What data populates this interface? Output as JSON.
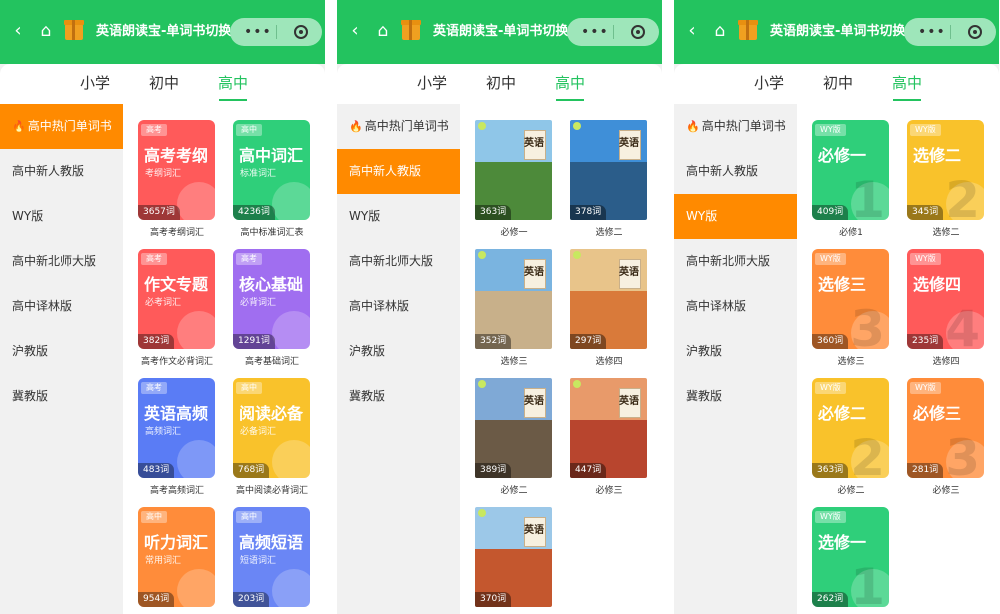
{
  "app": {
    "title": "英语朗读宝-单词书切换",
    "capsule_dots": "•••",
    "icons": [
      "back-icon",
      "home-icon",
      "gift-icon",
      "more-icon",
      "close-icon"
    ],
    "colors": {
      "header": "#23c35f",
      "active_side": "#ff8a00",
      "active_tab": "#23c35f"
    }
  },
  "panels": [
    {
      "tabs": [
        "小学",
        "初中",
        "高中"
      ],
      "active_tab": "高中",
      "side": [
        "高中热门单词书",
        "高中新人教版",
        "WY版",
        "高中新北师大版",
        "高中译林版",
        "沪教版",
        "冀教版"
      ],
      "active_side": "高中热门单词书",
      "cards": [
        {
          "tag": "高考",
          "big": "高考考纲",
          "sub": "考纲词汇",
          "count": "3657词",
          "label": "高考考纲词汇",
          "color": "#ff5a5a"
        },
        {
          "tag": "高中",
          "big": "高中词汇",
          "sub": "标准词汇",
          "count": "4236词",
          "label": "高中标准词汇表",
          "color": "#2fcf7a"
        },
        {
          "tag": "高考",
          "big": "作文专题",
          "sub": "必考词汇",
          "count": "382词",
          "label": "高考作文必背词汇",
          "color": "#ff5a5a"
        },
        {
          "tag": "高考",
          "big": "核心基础",
          "sub": "必背词汇",
          "count": "1291词",
          "label": "高考基础词汇",
          "color": "#a06ef0"
        },
        {
          "tag": "高考",
          "big": "英语高频",
          "sub": "高频词汇",
          "count": "483词",
          "label": "高考高频词汇",
          "color": "#5a7cf5"
        },
        {
          "tag": "高中",
          "big": "阅读必备",
          "sub": "必备词汇",
          "count": "768词",
          "label": "高中阅读必背词汇",
          "color": "#f9c22b"
        },
        {
          "tag": "高中",
          "big": "听力词汇",
          "sub": "常用词汇",
          "count": "954词",
          "label": "",
          "color": "#ff8c3a"
        },
        {
          "tag": "高中",
          "big": "高频短语",
          "sub": "短语词汇",
          "count": "203词",
          "label": "",
          "color": "#6a86f5"
        }
      ]
    },
    {
      "tabs": [
        "小学",
        "初中",
        "高中"
      ],
      "active_tab": "高中",
      "side": [
        "高中热门单词书",
        "高中新人教版",
        "WY版",
        "高中新北师大版",
        "高中译林版",
        "沪教版",
        "冀教版"
      ],
      "active_side": "高中新人教版",
      "books": [
        {
          "title": "英语",
          "count": "363词",
          "label": "必修一",
          "sky": "#8fc6e8",
          "ground": "#4d8a3a"
        },
        {
          "title": "英语",
          "count": "378词",
          "label": "选修二",
          "sky": "#3f8fd8",
          "ground": "#2b5d8a"
        },
        {
          "title": "英语",
          "count": "352词",
          "label": "选修三",
          "sky": "#7ab4e0",
          "ground": "#c8b08a"
        },
        {
          "title": "英语",
          "count": "297词",
          "label": "选修四",
          "sky": "#e8c48a",
          "ground": "#d97a3a"
        },
        {
          "title": "英语",
          "count": "389词",
          "label": "必修二",
          "sky": "#7fa9d6",
          "ground": "#6b5a46"
        },
        {
          "title": "英语",
          "count": "447词",
          "label": "必修三",
          "sky": "#e89a6a",
          "ground": "#b8452e"
        },
        {
          "title": "英语",
          "count": "370词",
          "label": "",
          "sky": "#9cc8e8",
          "ground": "#c4572e"
        }
      ]
    },
    {
      "tabs": [
        "小学",
        "初中",
        "高中"
      ],
      "active_tab": "高中",
      "side": [
        "高中热门单词书",
        "高中新人教版",
        "WY版",
        "高中新北师大版",
        "高中译林版",
        "沪教版",
        "冀教版"
      ],
      "active_side": "WY版",
      "cards": [
        {
          "tag": "WY版",
          "big": "必修一",
          "count": "409词",
          "label": "必修1",
          "color": "#2fcf7a",
          "num": "1"
        },
        {
          "tag": "WY版",
          "big": "选修二",
          "count": "345词",
          "label": "选修二",
          "color": "#f9c22b",
          "num": "2"
        },
        {
          "tag": "WY版",
          "big": "选修三",
          "count": "360词",
          "label": "选修三",
          "color": "#ff8c3a",
          "num": "3"
        },
        {
          "tag": "WY版",
          "big": "选修四",
          "count": "235词",
          "label": "选修四",
          "color": "#ff5a5a",
          "num": "4"
        },
        {
          "tag": "WY版",
          "big": "必修二",
          "count": "363词",
          "label": "必修二",
          "color": "#f9c22b",
          "num": "2"
        },
        {
          "tag": "WY版",
          "big": "必修三",
          "count": "281词",
          "label": "必修三",
          "color": "#ff8c3a",
          "num": "3"
        },
        {
          "tag": "WY版",
          "big": "选修一",
          "count": "262词",
          "label": "",
          "color": "#2fcf7a",
          "num": "1"
        }
      ]
    }
  ]
}
